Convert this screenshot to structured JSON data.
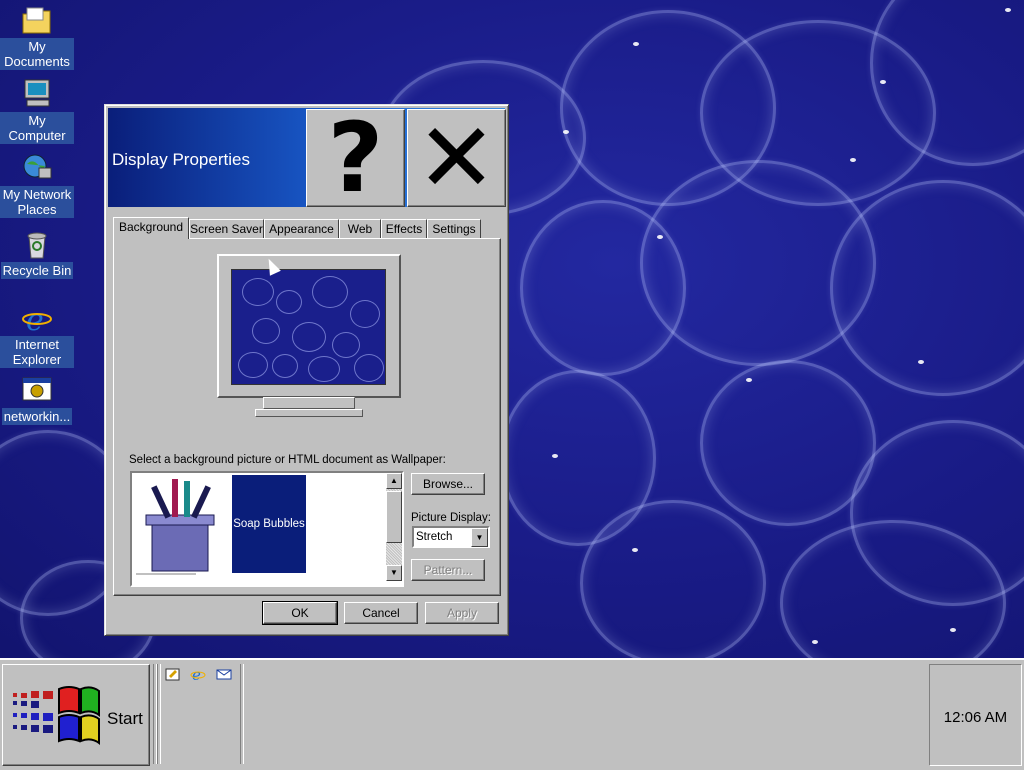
{
  "desktop": {
    "icons": [
      {
        "label": "My Documents"
      },
      {
        "label": "My Computer"
      },
      {
        "label": "My Network Places"
      },
      {
        "label": "Recycle Bin"
      },
      {
        "label": "Internet Explorer"
      },
      {
        "label": "networkin..."
      }
    ]
  },
  "dialog": {
    "title": "Display Properties",
    "help_glyph": "?",
    "close_glyph": "✕",
    "tabs": [
      {
        "label": "Background",
        "active": true
      },
      {
        "label": "Screen Saver"
      },
      {
        "label": "Appearance"
      },
      {
        "label": "Web"
      },
      {
        "label": "Effects"
      },
      {
        "label": "Settings"
      }
    ],
    "wallpaper_label": "Select a background picture or HTML document as Wallpaper:",
    "selected_wallpaper": "Soap Bubbles",
    "browse_button": "Browse...",
    "picture_display_label": "Picture Display:",
    "picture_display_value": "Stretch",
    "pattern_button": "Pattern...",
    "ok_button": "OK",
    "cancel_button": "Cancel",
    "apply_button": "Apply"
  },
  "taskbar": {
    "start_label": "Start",
    "clock": "12:06 AM"
  },
  "colors": {
    "desktop": "#16187c",
    "titlebar_start": "#0a1e7a",
    "titlebar_end": "#3b8de0",
    "chrome": "#c0c0c0",
    "selection": "#0a1e7a"
  }
}
